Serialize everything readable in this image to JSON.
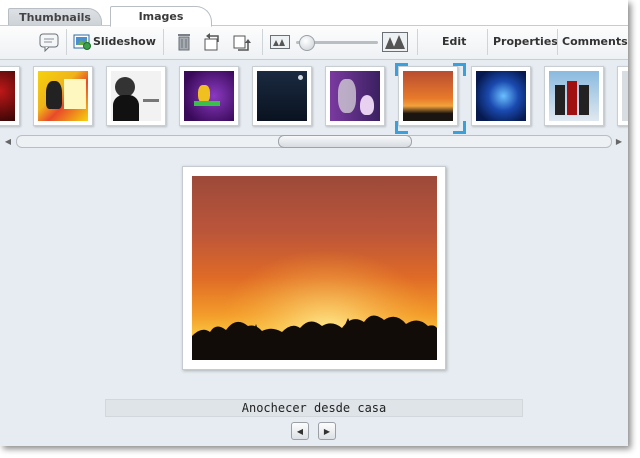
{
  "tabs": [
    {
      "label": "Thumbnails"
    },
    {
      "label": "Images"
    }
  ],
  "toolbar": {
    "slideshow_label": "Slideshow",
    "edit_label": "Edit",
    "properties_label": "Properties",
    "comments_label": "Comments",
    "icons": [
      "comment-icon",
      "slideshow-icon",
      "trash-icon",
      "rotate-left-icon",
      "rotate-right-icon",
      "zoom-small-icon",
      "zoom-large-icon"
    ],
    "zoom_level": 0.05
  },
  "filmstrip": {
    "selected_index": 6,
    "thumbnails": [
      {
        "name": "red-partial"
      },
      {
        "name": "yellow-collage"
      },
      {
        "name": "bw-portrait"
      },
      {
        "name": "purple-logo"
      },
      {
        "name": "dark-blue"
      },
      {
        "name": "purple-penguin"
      },
      {
        "name": "sunset"
      },
      {
        "name": "blue-swirl"
      },
      {
        "name": "costume-group"
      },
      {
        "name": "partial-right"
      }
    ],
    "scroll_position": 0.45
  },
  "viewer": {
    "caption": "Anochecer desde casa"
  },
  "colors": {
    "accent": "#3aa0dc",
    "background": "#e6ecf1"
  }
}
